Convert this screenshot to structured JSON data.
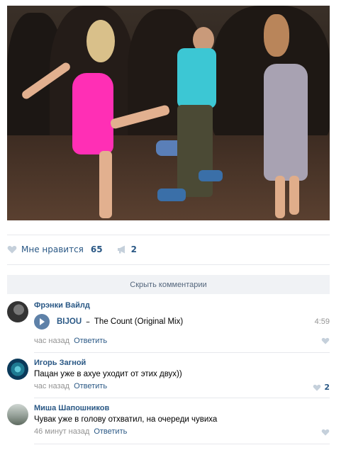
{
  "post": {
    "likes_label": "Мне нравится",
    "likes_count": "65",
    "shares_count": "2"
  },
  "hide_comments_label": "Скрыть комментарии",
  "comments": [
    {
      "author": "Фрэнки Вайлд",
      "audio": {
        "artist": "BIJOU",
        "dash": "–",
        "title": "The Count (Original Mix)",
        "duration": "4:59"
      },
      "time": "час назад",
      "reply": "Ответить",
      "likes": ""
    },
    {
      "author": "Игорь Загной",
      "text": "Пацан уже в ахуе уходит от этих двух))",
      "time": "час назад",
      "reply": "Ответить",
      "likes": "2"
    },
    {
      "author": "Миша Шапошников",
      "text": "Чувак уже в голову отхватил, на очереди чувиха",
      "time": "46 минут назад",
      "reply": "Ответить",
      "likes": ""
    }
  ],
  "colors": {
    "link": "#2a5885",
    "meta": "#939393",
    "divider": "#e7e8ec",
    "button_bg": "#f0f2f5"
  }
}
